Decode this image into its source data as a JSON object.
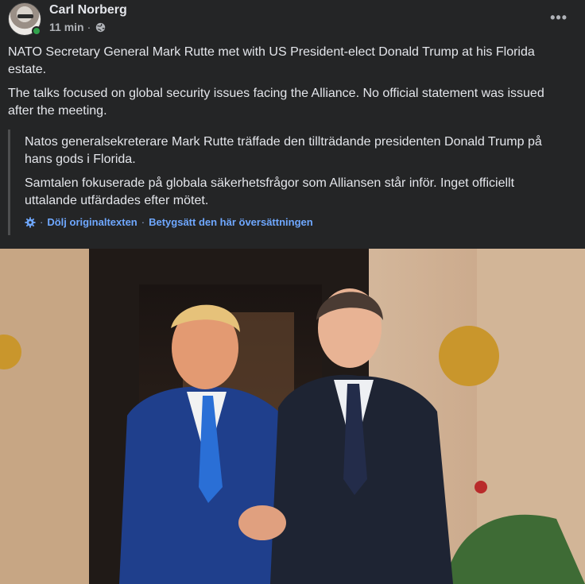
{
  "post": {
    "author": "Carl Norberg",
    "time": "11 min",
    "dot": "·",
    "more": "•••",
    "paragraphs": [
      "NATO Secretary General Mark Rutte met with US President-elect Donald Trump at his Florida estate.",
      "The talks focused on global security issues facing the Alliance. No official statement was issued after the meeting."
    ]
  },
  "translation": {
    "paragraphs": [
      "Natos generalsekreterare Mark Rutte träffade den tillträdande presidenten Donald Trump på hans gods i Florida.",
      "Samtalen fokuserade på globala säkerhetsfrågor som Alliansen står inför. Inget officiellt uttalande utfärdades efter mötet."
    ],
    "sep": "·",
    "hide_original": "Dölj originaltexten",
    "rate_translation": "Betygsätt den här översättningen"
  },
  "colors": {
    "background": "#242526",
    "text": "#e4e6eb",
    "muted": "#b0b3b8",
    "link": "#6fa8ff",
    "online": "#31a24c"
  },
  "icons": [
    "avatar",
    "online-status-icon",
    "globe-icon",
    "more-options-icon",
    "settings-gear-icon"
  ]
}
